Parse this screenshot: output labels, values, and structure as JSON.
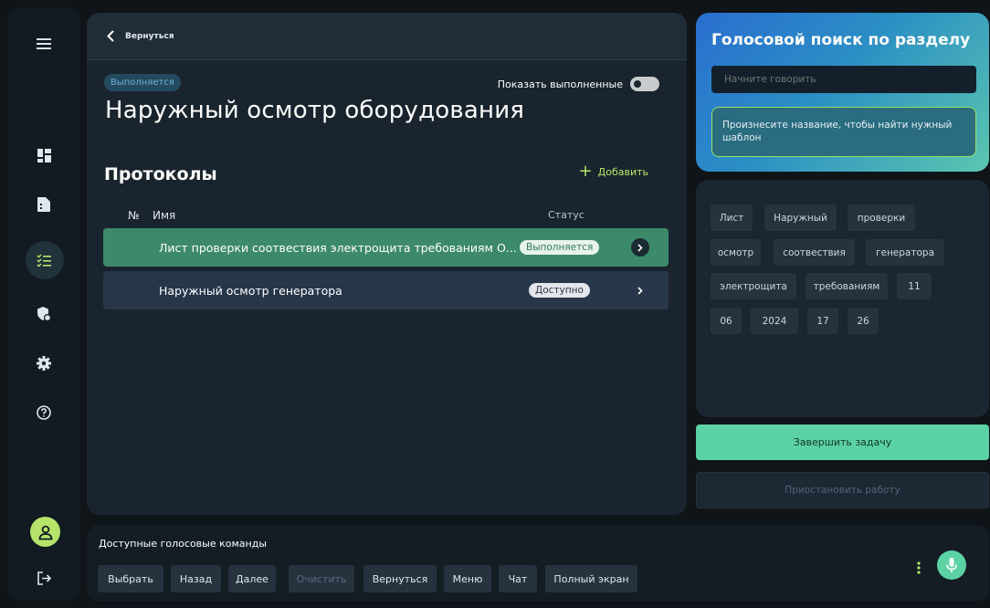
{
  "sidebar": {
    "items": [
      {
        "name": "menu-icon"
      },
      {
        "name": "dashboard-icon"
      },
      {
        "name": "document-icon"
      },
      {
        "name": "checklist-icon",
        "active": true
      },
      {
        "name": "shield-icon"
      },
      {
        "name": "gear-icon"
      },
      {
        "name": "help-icon"
      },
      {
        "name": "user-icon"
      },
      {
        "name": "logout-icon"
      }
    ]
  },
  "topbar": {
    "back_label": "Вернуться"
  },
  "task": {
    "status": "Выполняется",
    "title": "Наружный осмотр оборудования",
    "show_done_label": "Показать выполненные"
  },
  "protocols": {
    "title": "Протоколы",
    "add_label": "Добавить",
    "columns": {
      "num": "№",
      "name": "Имя",
      "status": "Статус"
    },
    "rows": [
      {
        "name": "Лист проверки соотвествия электрощита требованиям О...",
        "status": "Выполняется"
      },
      {
        "name": "Наружный осмотр генератора",
        "status": "Доступно"
      }
    ]
  },
  "voice": {
    "title": "Голосовой поиск по разделу",
    "placeholder": "Начните говорить",
    "hint": "Произнесите название, чтобы найти нужный шаблон"
  },
  "tags": [
    "Лист",
    "Наружный",
    "проверки",
    "осмотр",
    "соотвествия",
    "генератора",
    "электрощита",
    "требованиям",
    "11",
    "06",
    "2024",
    "17",
    "26"
  ],
  "actions": {
    "finish": "Завершить задачу",
    "pause": "Приостановить работу"
  },
  "commands": {
    "title": "Доступные голосовые команды",
    "items": [
      {
        "label": "Выбрать",
        "enabled": true
      },
      {
        "label": "Назад",
        "enabled": true
      },
      {
        "label": "Далее",
        "enabled": true
      },
      {
        "label": "Очистить",
        "enabled": false
      },
      {
        "label": "Вернуться",
        "enabled": true
      },
      {
        "label": "Меню",
        "enabled": true
      },
      {
        "label": "Чат",
        "enabled": true
      },
      {
        "label": "Полный экран",
        "enabled": true
      }
    ]
  },
  "colors": {
    "accent_green": "#5bd2a4",
    "lime": "#b7e86a",
    "active_row": "#3c8a6a"
  }
}
